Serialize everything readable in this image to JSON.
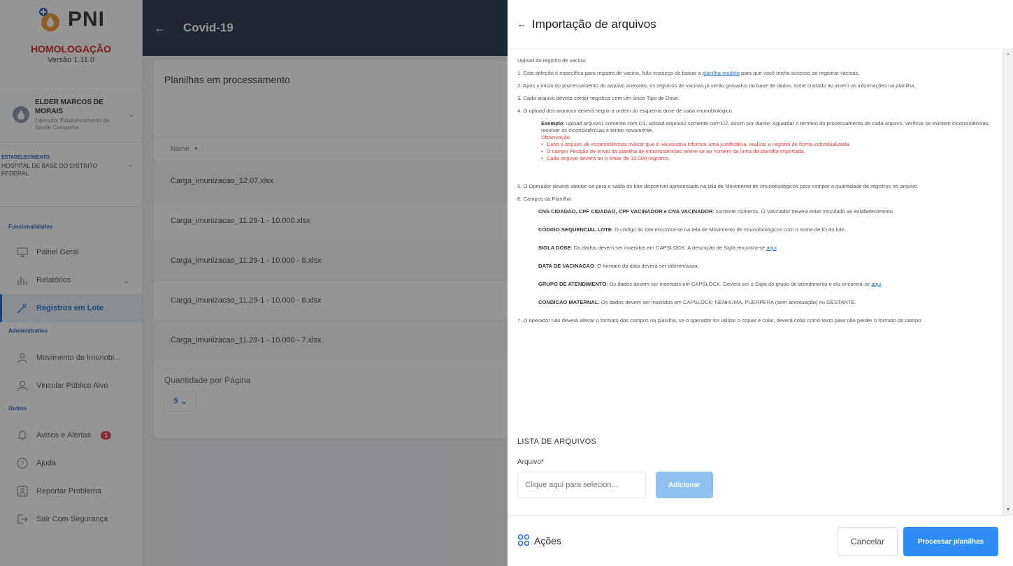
{
  "brand": {
    "name": "PNI",
    "environment": "HOMOLOGAÇÃO",
    "version": "Versão 1.11.0"
  },
  "user": {
    "name": "ELDER MARCOS DE MORAIS",
    "role": "Operador Estabelecimento de Saude Camparha"
  },
  "establishment": {
    "label": "ESTABELECIMENTO",
    "name": "HOSPITAL DE BASE DO DISTRITO FEDERAL"
  },
  "sidebar": {
    "section_functionalities": "Funcionalidades",
    "painel": "Painel Geral",
    "relatorios": "Relatórios",
    "registros": "Registros em Lote",
    "section_admin": "Administrativo",
    "movimento": "Movimento de Imunobi...",
    "vincular": "Vincular Público Alvo",
    "section_outros": "Outros",
    "avisos": "Avisos e Alertas",
    "avisos_count": "1",
    "ajuda": "Ajuda",
    "reportar": "Reportar Problema",
    "sair": "Sair Com Segurança"
  },
  "topbar": {
    "title": "Covid-19"
  },
  "card": {
    "title": "Planilhas em processamento",
    "column_name": "Nome",
    "rows": [
      "Carga_imunizacao_12.07.xlsx",
      "Carga_imunizacao_11.29-1 - 10.000.xlsx",
      "Carga_imunizacao_11.29-1 - 10.000 - 8.xlsx",
      "Carga_imunizacao_11.29-1 - 10.000 - 8.xlsx",
      "Carga_imunizacao_11.29-1 - 10.000 - 7.xlsx"
    ],
    "qty_label": "Quantidade por Página",
    "qty_value": "5"
  },
  "panel": {
    "title": "Importação de arquivos",
    "upload_heading": "Upload do registro de vacina:",
    "item1_a": "1. Esta seleção é específica para registro de vacina. Não esqueça de baixar a ",
    "item1_link": "planilha modelo",
    "item1_b": " para que você tenha sucesso ao registrar vacinas.",
    "item2": "2. Após o início do processamento do arquivo anexado, os registros de vacinas já serão gravados na base de dados, tome cuidado ao inserir as informações na planilha.",
    "item3": "3. Cada arquivo deverá conter registros com um único Tipo de Dose.",
    "item4": "4. O upload dos arquivos deverá seguir a ordem do esquema dose de cada imunobiológico:",
    "example_label": "Exemplo",
    "example_text": ": upload arquivo1 somente com D1, upload arquivo2 somente com D2, assim por diante. Aguardar o término do processamento de cada arquivo, verificar se existem inconsistências, resolver as inconsistências e tentar novamente.",
    "obs_title": "Observação:",
    "obs_items": [
      "Caso o arquivo de inconsistências indicar que é necessário informar uma justificativa, realizar o registro de forma individualizada.",
      "O campo Posição de envio da planilha de inconsistências refere-se ao número da linha da planilha importada.",
      "Cada arquivo deverá ter o limite de 10.000 registros."
    ],
    "item5": "5. O Operador deverá atentar-se para o saldo do lote disponível apresentado na tela de Movimento de Imunobiológicos para compor a quantidade de registros no arquivo.",
    "item6": "6. Campos da Planilha:",
    "field_cns_label": "CNS CIDADAO, CPF CIDADAO, CPF VACINADOR e CNS VACINADOR",
    "field_cns_text": ": somente números. O Vacinador deverá estar vinculado ao estabelecimento.",
    "field_lote_label": "CÓDIGO SEQUENCIAL LOTE",
    "field_lote_text": ": O código do lote encontra-se na tela de Movimento de Imunobiológicos com o nome de ID do lote.",
    "field_dose_label": "SIGLA DOSE",
    "field_dose_text": ": Os dados devem ser inseridos em CAPSLOCK. A descrição de Sigla encontra-se ",
    "field_dose_link": "aqui",
    "field_data_label": "DATA DE VACINACAO",
    "field_data_text": ": O formato da data deverá ser dd/mm/aaaa.",
    "field_grupo_label": "GRUPO DE ATENDIMENTO",
    "field_grupo_text": ": Os dados devem ser inseridos em CAPSLOCK. Deverá ser a Sigla do grupo de atendimento e ela encontra-se ",
    "field_grupo_link": "aqui",
    "field_cond_label": "CONDICAO MATERNAL",
    "field_cond_text": ": Os dados devem ser inseridos em CAPSLOCK: NENHUMA, PUERPERA (sem acentuação) ou GESTANTE.",
    "item7": "7. O operador não deverá alterar o formato dos campos na planilha, se o operador for utilizar o copiar e colar, deverá colar como texto para não perder o formato do campo.",
    "lista_title": "LISTA DE ARQUIVOS",
    "arquivo_label": "Arquivo*",
    "file_placeholder": "Clique aqui para selecion...",
    "add_button": "Adicionar",
    "acoes": "Ações",
    "cancel_button": "Cancelar",
    "process_button": "Processar planilhas"
  },
  "colors": {
    "accent": "#1f6fc9",
    "topbar": "#24364f",
    "danger": "#e23d3d",
    "primary_button": "#2e8df2"
  }
}
